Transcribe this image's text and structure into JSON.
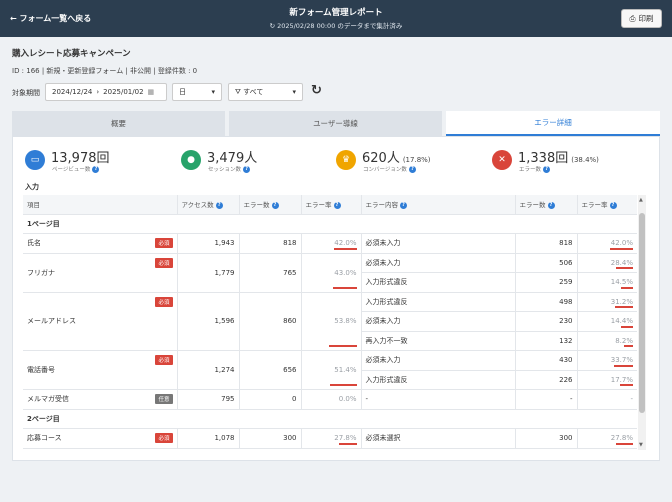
{
  "header": {
    "back_label": "← フォーム一覧へ戻る",
    "title": "新フォーム管理レポート",
    "subtitle": "2025/02/28 00:00 のデータまで集計済み",
    "print_label": "印刷"
  },
  "campaign": {
    "name": "購入レシート応募キャンペーン",
    "meta": "ID : 166 | 新規・更新登録フォーム | 非公開 | 登録件数 : 0"
  },
  "filters": {
    "period_label": "対象期間",
    "date_from": "2024/12/24",
    "date_sep": "›",
    "date_to": "2025/01/02",
    "unit_value": "日",
    "device_value": "すべて"
  },
  "tabs": [
    {
      "label": "概要",
      "active": false
    },
    {
      "label": "ユーザー導線",
      "active": false
    },
    {
      "label": "エラー詳細",
      "active": true
    }
  ],
  "kpis": [
    {
      "value": "13,978回",
      "extra": "",
      "label": "ページビュー数",
      "color": "#2f7dd6",
      "icon": "browser-icon"
    },
    {
      "value": "3,479人",
      "extra": "",
      "label": "セッション数",
      "color": "#27a36a",
      "icon": "user-icon"
    },
    {
      "value": "620人",
      "extra": "(17.8%)",
      "label": "コンバージョン数",
      "color": "#f0a500",
      "icon": "crown-icon"
    },
    {
      "value": "1,338回",
      "extra": "(38.4%)",
      "label": "エラー数",
      "color": "#d9453a",
      "icon": "cross-icon"
    }
  ],
  "section_title": "入力",
  "table": {
    "headers": [
      "項目",
      "アクセス数",
      "エラー数",
      "エラー率",
      "エラー内容",
      "エラー数",
      "エラー率"
    ],
    "page1": "1ページ目",
    "page2": "2ページ目",
    "req_label": "必須",
    "opt_label": "任意",
    "rows": [
      {
        "name": "氏名",
        "badge": "req",
        "access": "1,943",
        "errors": "818",
        "rate": "42.0%",
        "rate_val": 42.0,
        "details": [
          {
            "content": "必須未入力",
            "count": "818",
            "rate": "42.0%",
            "rate_val": 42.0
          }
        ]
      },
      {
        "name": "フリガナ",
        "badge": "req",
        "access": "1,779",
        "errors": "765",
        "rate": "43.0%",
        "rate_val": 43.0,
        "details": [
          {
            "content": "必須未入力",
            "count": "506",
            "rate": "28.4%",
            "rate_val": 28.4
          },
          {
            "content": "入力形式違反",
            "count": "259",
            "rate": "14.5%",
            "rate_val": 14.5
          }
        ]
      },
      {
        "name": "メールアドレス",
        "badge": "req",
        "access": "1,596",
        "errors": "860",
        "rate": "53.8%",
        "rate_val": 53.8,
        "details": [
          {
            "content": "入力形式違反",
            "count": "498",
            "rate": "31.2%",
            "rate_val": 31.2
          },
          {
            "content": "必須未入力",
            "count": "230",
            "rate": "14.4%",
            "rate_val": 14.4
          },
          {
            "content": "再入力不一致",
            "count": "132",
            "rate": "8.2%",
            "rate_val": 8.2
          }
        ]
      },
      {
        "name": "電話番号",
        "badge": "req",
        "access": "1,274",
        "errors": "656",
        "rate": "51.4%",
        "rate_val": 51.4,
        "details": [
          {
            "content": "必須未入力",
            "count": "430",
            "rate": "33.7%",
            "rate_val": 33.7
          },
          {
            "content": "入力形式違反",
            "count": "226",
            "rate": "17.7%",
            "rate_val": 17.7
          }
        ]
      },
      {
        "name": "メルマガ受信",
        "badge": "opt",
        "access": "795",
        "errors": "0",
        "rate": "0.0%",
        "rate_val": 0,
        "details": [
          {
            "content": "-",
            "count": "-",
            "rate": "-",
            "rate_val": 0
          }
        ]
      }
    ],
    "page2_rows": [
      {
        "name": "応募コース",
        "badge": "req",
        "access": "1,078",
        "errors": "300",
        "rate": "27.8%",
        "rate_val": 27.8,
        "details": [
          {
            "content": "必須未選択",
            "count": "300",
            "rate": "27.8%",
            "rate_val": 27.8
          }
        ]
      }
    ]
  }
}
